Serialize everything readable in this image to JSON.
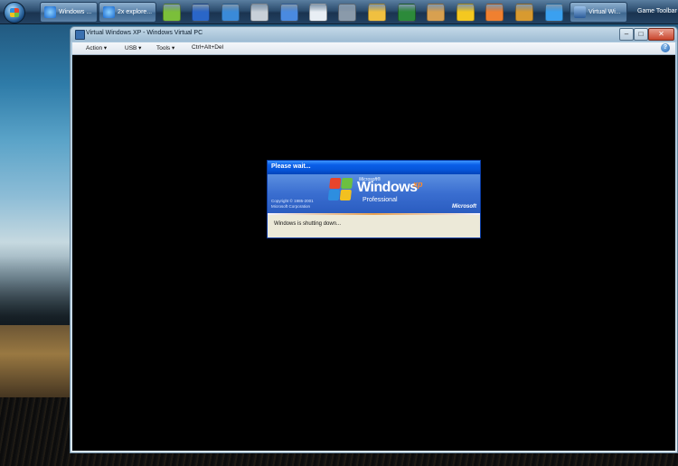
{
  "taskbar": {
    "buttons": [
      {
        "label": "Windows ..."
      },
      {
        "label": "2x explore..."
      }
    ],
    "icons": [
      {
        "name": "users-icon",
        "color": "#7bbf3a"
      },
      {
        "name": "outlook-icon",
        "color": "#2a66c8"
      },
      {
        "name": "window-icon",
        "color": "#3a8ad8"
      },
      {
        "name": "printer-icon",
        "color": "#c8d0d8"
      },
      {
        "name": "network-icon",
        "color": "#4a8ae0"
      },
      {
        "name": "document-icon",
        "color": "#e8eef4"
      },
      {
        "name": "tools-icon",
        "color": "#8a9aaa"
      },
      {
        "name": "folder-icon",
        "color": "#f0c040"
      },
      {
        "name": "excel-icon",
        "color": "#2c8a3a"
      },
      {
        "name": "winamp-icon",
        "color": "#d8a050"
      },
      {
        "name": "star-icon",
        "color": "#f4c820"
      },
      {
        "name": "media-player-icon",
        "color": "#f08030"
      },
      {
        "name": "film-icon",
        "color": "#d89a30"
      },
      {
        "name": "app-icon",
        "color": "#3aa0f0"
      }
    ],
    "active_button": {
      "label": "Virtual Wi..."
    },
    "game_toolbar_label": "Game Toolbar"
  },
  "vm_window": {
    "title": "Virtual Windows XP - Windows Virtual PC",
    "menu": [
      {
        "label": "Action ▾"
      },
      {
        "label": "USB ▾"
      },
      {
        "label": "Tools ▾"
      },
      {
        "label": "Ctrl+Alt+Del"
      }
    ],
    "controls": {
      "minimize": "–",
      "maximize": "□",
      "close": "✕"
    },
    "help": "?"
  },
  "xp_dialog": {
    "title": "Please wait...",
    "brand_small": "Microsoft®",
    "brand": "Windows",
    "brand_xp": "xp",
    "edition": "Professional",
    "copyright_1": "Copyright © 1985-2001",
    "copyright_2": "Microsoft Corporation",
    "ms_logo": "Microsoft",
    "message": "Windows is shutting down..."
  }
}
